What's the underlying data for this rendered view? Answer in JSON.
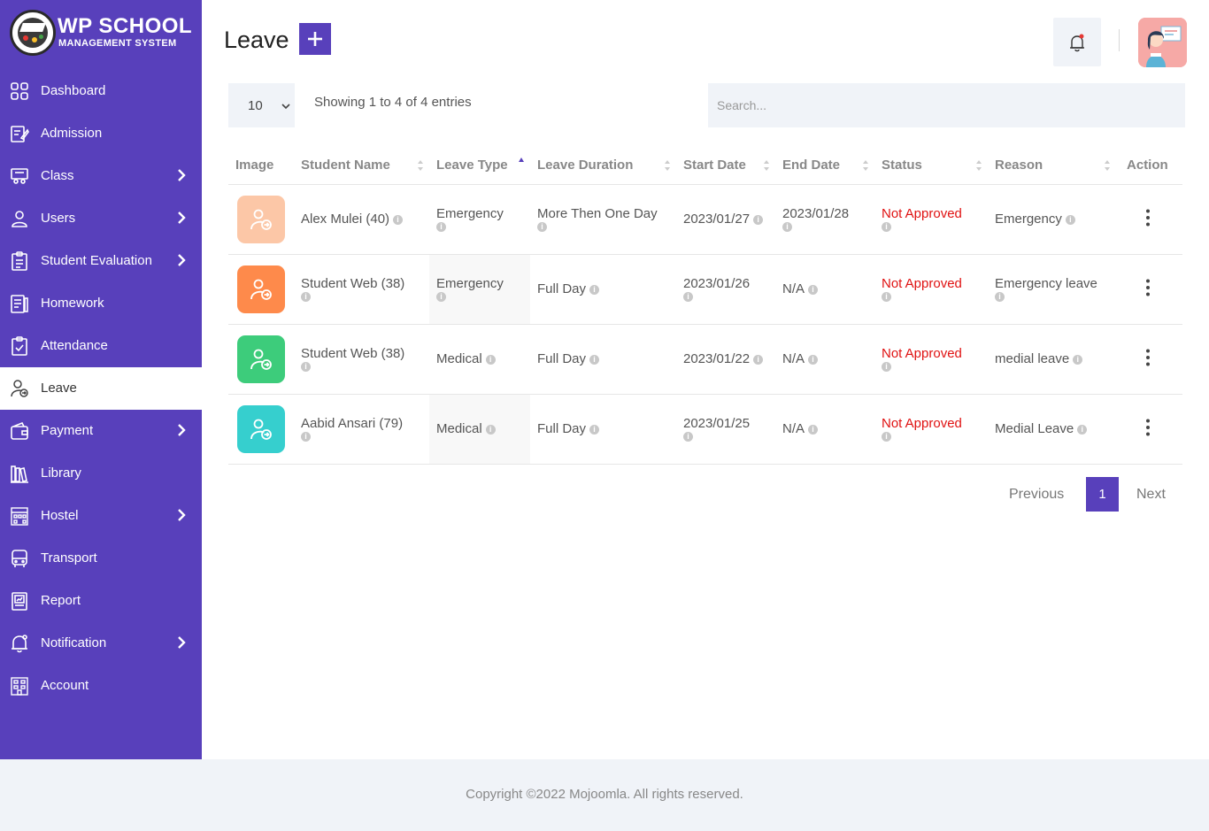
{
  "brand": {
    "title": "WP SCHOOL",
    "subtitle": "MANAGEMENT SYSTEM"
  },
  "colors": {
    "accent": "#5840bb",
    "status_red": "#e01212",
    "row1_img": "#fcc7a7",
    "row2_img": "#fe8a4b",
    "row3_img": "#3dcc7b",
    "row4_img": "#36cfce"
  },
  "sidebar": {
    "items": [
      {
        "label": "Dashboard",
        "icon": "dashboard-icon",
        "chevron": false
      },
      {
        "label": "Admission",
        "icon": "admission-icon",
        "chevron": false
      },
      {
        "label": "Class",
        "icon": "class-icon",
        "chevron": true
      },
      {
        "label": "Users",
        "icon": "user-icon",
        "chevron": true
      },
      {
        "label": "Student Evaluation",
        "icon": "evaluation-icon",
        "chevron": true
      },
      {
        "label": "Homework",
        "icon": "homework-icon",
        "chevron": false
      },
      {
        "label": "Attendance",
        "icon": "attendance-icon",
        "chevron": false
      },
      {
        "label": "Leave",
        "icon": "leave-icon",
        "chevron": false,
        "active": true
      },
      {
        "label": "Payment",
        "icon": "payment-icon",
        "chevron": true
      },
      {
        "label": "Library",
        "icon": "library-icon",
        "chevron": false
      },
      {
        "label": "Hostel",
        "icon": "hostel-icon",
        "chevron": true
      },
      {
        "label": "Transport",
        "icon": "bus-icon",
        "chevron": false
      },
      {
        "label": "Report",
        "icon": "report-icon",
        "chevron": false
      },
      {
        "label": "Notification",
        "icon": "notification-icon",
        "chevron": true
      },
      {
        "label": "Account",
        "icon": "account-icon",
        "chevron": false
      }
    ]
  },
  "header": {
    "title": "Leave",
    "add_icon": "plus-icon",
    "bell_icon": "bell-icon"
  },
  "table_controls": {
    "page_length": "10",
    "showing": "Showing 1 to 4 of 4 entries",
    "search_placeholder": "Search..."
  },
  "table": {
    "columns": [
      "Image",
      "Student Name",
      "Leave Type",
      "Leave Duration",
      "Start Date",
      "End Date",
      "Status",
      "Reason",
      "Action"
    ],
    "rows": [
      {
        "student": "Alex Mulei (40)",
        "type": "Emergency",
        "duration": "More Then One Day",
        "start": "2023/01/27",
        "end": "2023/01/28",
        "status": "Not Approved",
        "reason": "Emergency"
      },
      {
        "student": "Student Web (38)",
        "type": "Emergency",
        "duration": "Full Day",
        "start": "2023/01/26",
        "end": "N/A",
        "status": "Not Approved",
        "reason": "Emergency leave"
      },
      {
        "student": "Student Web (38)",
        "type": "Medical",
        "duration": "Full Day",
        "start": "2023/01/22",
        "end": "N/A",
        "status": "Not Approved",
        "reason": "medial leave"
      },
      {
        "student": "Aabid Ansari (79)",
        "type": "Medical",
        "duration": "Full Day",
        "start": "2023/01/25",
        "end": "N/A",
        "status": "Not Approved",
        "reason": "Medial Leave"
      }
    ]
  },
  "pagination": {
    "previous": "Previous",
    "current": "1",
    "next": "Next"
  },
  "footer": {
    "copyright": "Copyright ©2022 Mojoomla. All rights reserved."
  }
}
